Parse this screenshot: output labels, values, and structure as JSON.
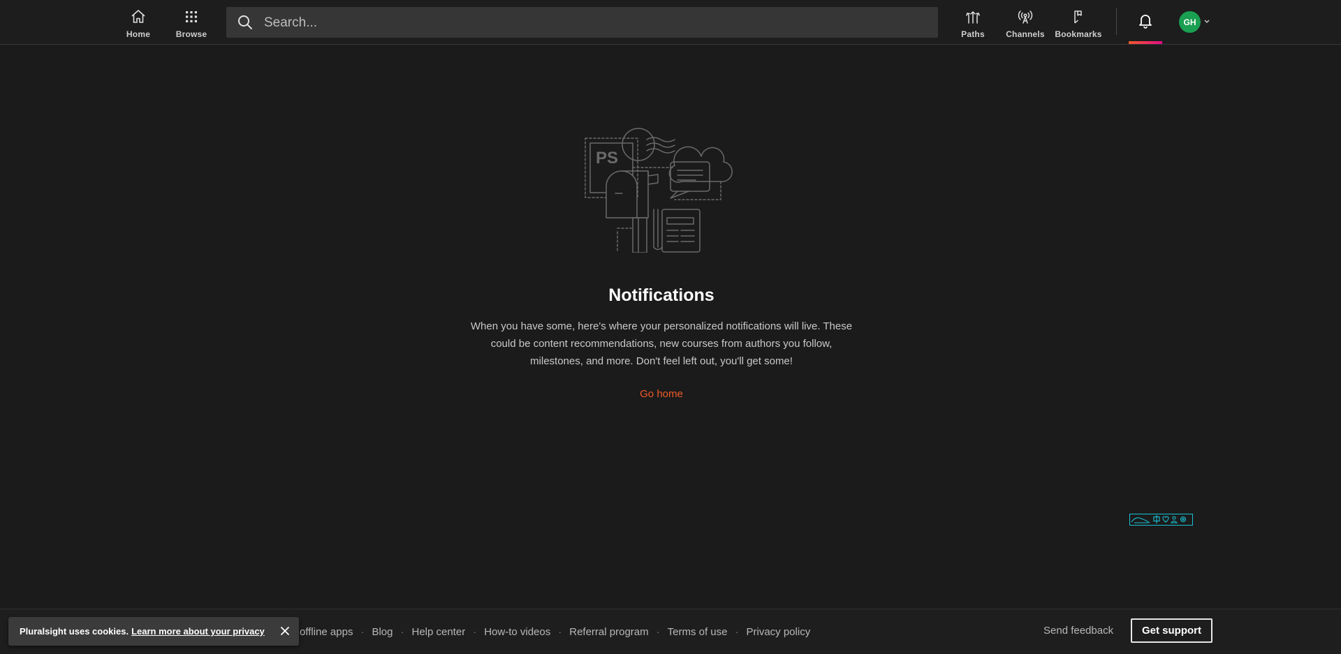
{
  "nav": {
    "home_label": "Home",
    "browse_label": "Browse",
    "search_placeholder": "Search...",
    "paths_label": "Paths",
    "channels_label": "Channels",
    "bookmarks_label": "Bookmarks",
    "avatar_initials": "GH"
  },
  "empty_state": {
    "illustration_text": "PS",
    "title": "Notifications",
    "description": "When you have some, here's where your personalized notifications will live. These could be content recommendations, new courses from authors you follow, milestones, and more. Don't feel left out, you'll get some!",
    "go_home_label": "Go home"
  },
  "footer": {
    "links": [
      "offline apps",
      "Blog",
      "Help center",
      "How-to videos",
      "Referral program",
      "Terms of use",
      "Privacy policy"
    ],
    "separator": "·",
    "send_feedback_label": "Send feedback",
    "get_support_label": "Get support"
  },
  "cookie_banner": {
    "text": "Pluralsight uses cookies.",
    "link_label": "Learn more about your privacy"
  },
  "colors": {
    "accent_orange": "#f15b2a",
    "accent_pink": "#e80a89",
    "avatar_green": "#1a9f52",
    "widget_cyan": "#19c3d6",
    "background": "#1b1b1b"
  }
}
